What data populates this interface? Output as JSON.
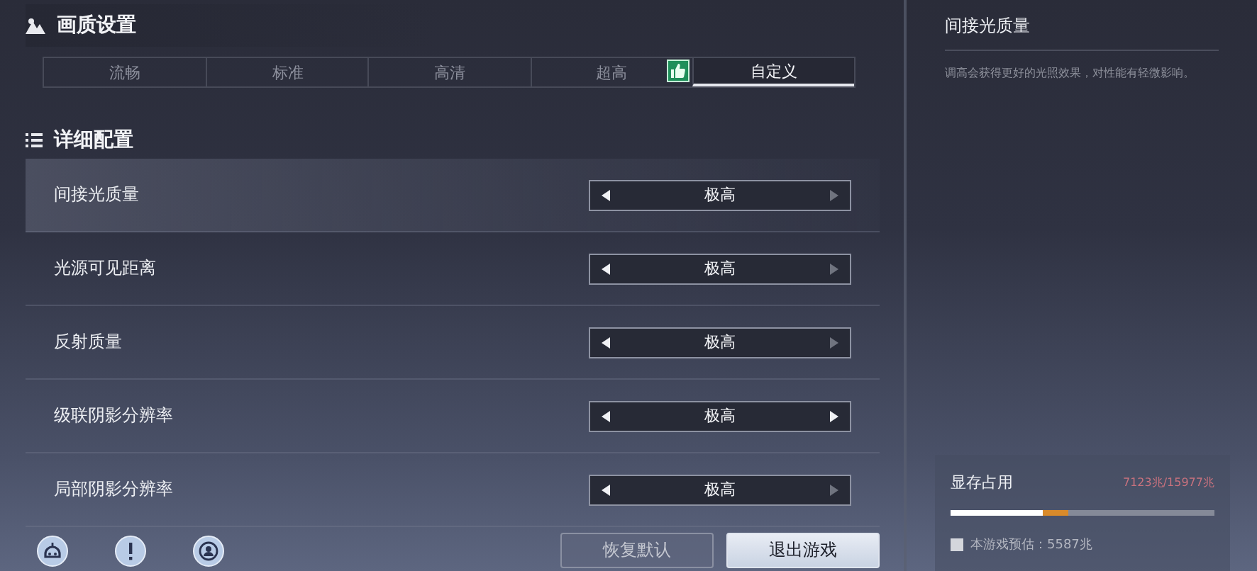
{
  "quality": {
    "title": "画质设置",
    "tabs": [
      {
        "label": "流畅",
        "selected": false,
        "recommended": false
      },
      {
        "label": "标准",
        "selected": false,
        "recommended": false
      },
      {
        "label": "高清",
        "selected": false,
        "recommended": false
      },
      {
        "label": "超高",
        "selected": false,
        "recommended": true
      },
      {
        "label": "自定义",
        "selected": true,
        "recommended": false
      }
    ]
  },
  "details": {
    "title": "详细配置",
    "rows": [
      {
        "label": "间接光质量",
        "value": "极高",
        "selected": true,
        "can_decrease": true,
        "can_increase": false
      },
      {
        "label": "光源可见距离",
        "value": "极高",
        "selected": false,
        "can_decrease": true,
        "can_increase": false
      },
      {
        "label": "反射质量",
        "value": "极高",
        "selected": false,
        "can_decrease": true,
        "can_increase": false
      },
      {
        "label": "级联阴影分辨率",
        "value": "极高",
        "selected": false,
        "can_decrease": true,
        "can_increase": true
      },
      {
        "label": "局部阴影分辨率",
        "value": "极高",
        "selected": false,
        "can_decrease": true,
        "can_increase": false
      }
    ]
  },
  "buttons": [
    {
      "label": "恢复默认",
      "kind": "secondary"
    },
    {
      "label": "退出游戏",
      "kind": "primary"
    }
  ],
  "info": {
    "title": "间接光质量",
    "description": "调高会获得更好的光照效果，对性能有轻微影响。"
  },
  "memory": {
    "title": "显存占用",
    "reading": "7123兆/15977兆",
    "level": 0.446,
    "game": {
      "level": 0.35,
      "legend": "本游戏预估：5587兆"
    }
  }
}
